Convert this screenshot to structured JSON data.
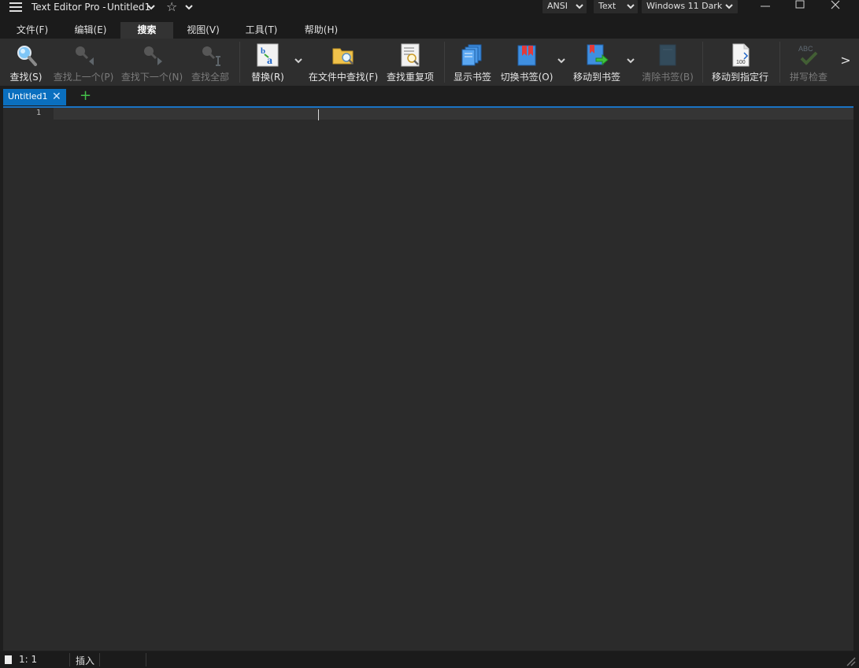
{
  "titlebar": {
    "app_name": "Text Editor Pro",
    "separator": "-",
    "doc_name": "Untitled1",
    "encoding": "ANSI",
    "highlighter": "Text",
    "theme": "Windows 11 Dark"
  },
  "menu_tabs": [
    "文件(F)",
    "编辑(E)",
    "搜索",
    "视图(V)",
    "工具(T)",
    "帮助(H)"
  ],
  "ribbon": {
    "search": "查找(S)",
    "find_prev": "查找上一个(P)",
    "find_next": "查找下一个(N)",
    "find_all": "查找全部",
    "replace": "替换(R)",
    "find_in_files": "在文件中查找(F)",
    "find_duplicates": "查找重复项",
    "show_bookmarks": "显示书签",
    "toggle_bookmark": "切换书签(O)",
    "goto_bookmark": "移动到书签",
    "clear_bookmarks": "清除书签(B)",
    "goto_line": "移动到指定行",
    "spell_check": "拼写检查",
    "more": ">"
  },
  "document": {
    "tab_label": "Untitled1",
    "add_tab": "+",
    "line_number": "1"
  },
  "status": {
    "position": "1: 1",
    "mode": "插入"
  },
  "colors": {
    "accent": "#0a6fbf",
    "background": "#1e1e1e",
    "editor_bg": "#2b2b2b",
    "ribbon_bg": "#2e2e2e",
    "add_tab_green": "#44c04a"
  }
}
